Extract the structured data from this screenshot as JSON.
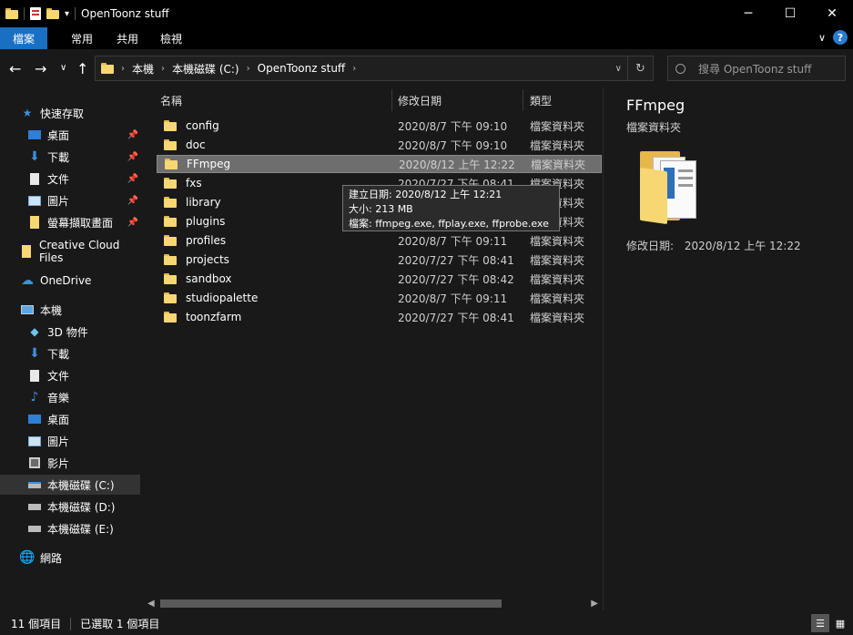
{
  "window": {
    "title": "OpenToonz stuff",
    "minimize": "─",
    "maximize": "☐",
    "close": "✕"
  },
  "ribbon": {
    "tabs": [
      "檔案",
      "常用",
      "共用",
      "檢視"
    ],
    "collapse_glyph": "∨",
    "help_glyph": "?"
  },
  "nav": {
    "back": "←",
    "forward": "→",
    "recent": "∨",
    "up": "↑"
  },
  "address": {
    "crumbs": [
      "本機",
      "本機磁碟 (C:)",
      "OpenToonz stuff"
    ],
    "chevron": "›",
    "refresh": "↻",
    "dropdown": "∨"
  },
  "search": {
    "placeholder": "搜尋 OpenToonz stuff"
  },
  "sidebar": {
    "quick_access": "快速存取",
    "quick_items": [
      "桌面",
      "下載",
      "文件",
      "圖片",
      "螢幕擷取畫面"
    ],
    "creative_cloud": "Creative Cloud Files",
    "onedrive": "OneDrive",
    "this_pc": "本機",
    "pc_items": [
      "3D 物件",
      "下載",
      "文件",
      "音樂",
      "桌面",
      "圖片",
      "影片",
      "本機磁碟 (C:)",
      "本機磁碟 (D:)",
      "本機磁碟 (E:)"
    ],
    "network": "網路"
  },
  "columns": {
    "name": "名稱",
    "date": "修改日期",
    "type": "類型"
  },
  "files": [
    {
      "name": "config",
      "date": "2020/8/7 下午 09:10",
      "type": "檔案資料夾"
    },
    {
      "name": "doc",
      "date": "2020/8/7 下午 09:10",
      "type": "檔案資料夾"
    },
    {
      "name": "FFmpeg",
      "date": "2020/8/12 上午 12:22",
      "type": "檔案資料夾"
    },
    {
      "name": "fxs",
      "date": "2020/7/27 下午 08:41",
      "type": "檔案資料夾"
    },
    {
      "name": "library",
      "date": "",
      "type": "檔案資料夾"
    },
    {
      "name": "plugins",
      "date": "",
      "type": "檔案資料夾"
    },
    {
      "name": "profiles",
      "date": "2020/8/7 下午 09:11",
      "type": "檔案資料夾"
    },
    {
      "name": "projects",
      "date": "2020/7/27 下午 08:41",
      "type": "檔案資料夾"
    },
    {
      "name": "sandbox",
      "date": "2020/7/27 下午 08:42",
      "type": "檔案資料夾"
    },
    {
      "name": "studiopalette",
      "date": "2020/8/7 下午 09:11",
      "type": "檔案資料夾"
    },
    {
      "name": "toonzfarm",
      "date": "2020/7/27 下午 08:41",
      "type": "檔案資料夾"
    }
  ],
  "tooltip": {
    "line1": "建立日期: 2020/8/12 上午 12:21",
    "line2": "大小: 213 MB",
    "line3": "檔案: ffmpeg.exe, ffplay.exe, ffprobe.exe"
  },
  "preview": {
    "title": "FFmpeg",
    "type": "檔案資料夾",
    "date_label": "修改日期:",
    "date_value": "2020/8/12 上午 12:22"
  },
  "status": {
    "count": "11 個項目",
    "selected": "已選取 1 個項目"
  },
  "colors": {
    "accent": "#1a6fc2",
    "folder": "#f7d674",
    "background": "#191919"
  }
}
